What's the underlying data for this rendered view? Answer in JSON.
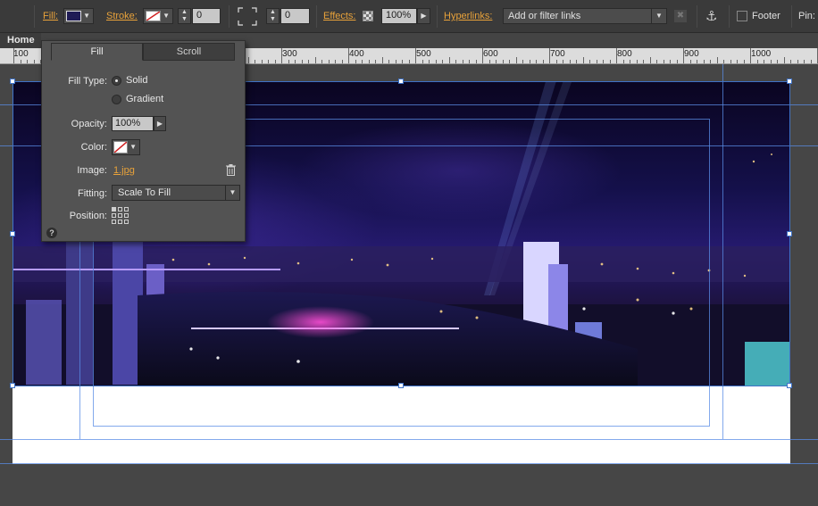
{
  "toolbar": {
    "fill_label": "Fill:",
    "stroke_label": "Stroke:",
    "stroke_width": "0",
    "corner_radius": "0",
    "effects_label": "Effects:",
    "effects_opacity": "100%",
    "hyperlinks_label": "Hyperlinks:",
    "hyperlinks_placeholder": "Add or filter links",
    "footer_label": "Footer",
    "pin_label": "Pin:"
  },
  "page_tab": {
    "label": "Home"
  },
  "ruler": {
    "labels": [
      "100",
      "300",
      "400",
      "500",
      "600",
      "700",
      "800",
      "900",
      "1000"
    ]
  },
  "fill_panel": {
    "tabs": [
      "Fill",
      "Scroll"
    ],
    "active_tab": "Fill",
    "fill_type_label": "Fill Type:",
    "fill_type_options": [
      "Solid",
      "Gradient"
    ],
    "fill_type_selected": "Solid",
    "opacity_label": "Opacity:",
    "opacity_value": "100%",
    "color_label": "Color:",
    "image_label": "Image:",
    "image_file": "1.jpg",
    "fitting_label": "Fitting:",
    "fitting_value": "Scale To Fill",
    "position_label": "Position:",
    "help_glyph": "?"
  },
  "colors": {
    "accent": "#e8a23a",
    "guide": "#5a8ce6",
    "panel_bg": "#535353",
    "toolbar_bg": "#3a3a3a"
  }
}
